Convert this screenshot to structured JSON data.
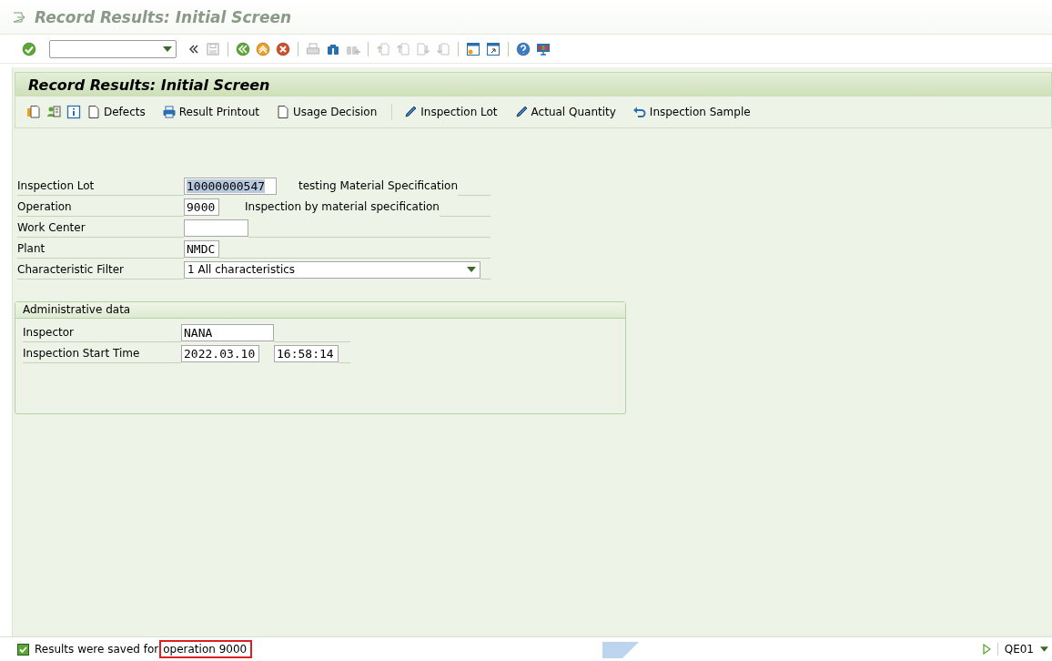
{
  "window": {
    "title": "Record Results: Initial Screen"
  },
  "system_toolbar": {
    "groups": [
      [
        {
          "kind": "enter",
          "disabled": false
        }
      ],
      [
        {
          "kind": "collapse",
          "disabled": false
        },
        {
          "kind": "save",
          "disabled": true
        }
      ],
      [
        {
          "kind": "back",
          "disabled": false
        },
        {
          "kind": "exit",
          "disabled": false
        },
        {
          "kind": "cancel",
          "disabled": false
        }
      ],
      [
        {
          "kind": "print",
          "disabled": true
        },
        {
          "kind": "find",
          "disabled": false
        },
        {
          "kind": "find-next",
          "disabled": true
        }
      ],
      [
        {
          "kind": "first-page",
          "disabled": true
        },
        {
          "kind": "previous-page",
          "disabled": true
        },
        {
          "kind": "next-page",
          "disabled": true
        },
        {
          "kind": "last-page",
          "disabled": true
        }
      ],
      [
        {
          "kind": "new-session",
          "disabled": false
        },
        {
          "kind": "shortcut",
          "disabled": false
        }
      ],
      [
        {
          "kind": "help",
          "disabled": false
        },
        {
          "kind": "layout",
          "disabled": false
        }
      ]
    ]
  },
  "screen_title": "Record Results: Initial Screen",
  "application_toolbar": [
    [
      {
        "kind": "change-view"
      },
      {
        "kind": "person-list"
      },
      {
        "kind": "info"
      },
      {
        "kind": "document",
        "label": "Defects"
      },
      {
        "kind": "printer",
        "label": "Result Printout"
      },
      {
        "kind": "document",
        "label": "Usage Decision"
      }
    ],
    [
      {
        "kind": "pencil",
        "label": "Inspection Lot"
      },
      {
        "kind": "pencil",
        "label": "Actual Quantity"
      },
      {
        "kind": "undo",
        "label": "Inspection Sample"
      }
    ]
  ],
  "fields": [
    {
      "label": "Inspection Lot",
      "kind": "input",
      "value": "10000000547",
      "highlighted": true,
      "description": "testing Material Specification"
    },
    {
      "label": "Operation",
      "kind": "input",
      "value": "9000",
      "description": "Inspection by material specification"
    },
    {
      "label": "Work Center",
      "kind": "input"
    },
    {
      "label": "Plant",
      "kind": "input",
      "value": "NMDC"
    },
    {
      "label": "Characteristic Filter",
      "kind": "dropdown",
      "value": "1 All characteristics"
    }
  ],
  "administrative_data": {
    "title": "Administrative data",
    "fields": [
      {
        "label": "Inspector",
        "values": [
          "NANA"
        ]
      },
      {
        "label": "Inspection Start Time",
        "values": [
          "2022.03.10",
          "16:58:14"
        ]
      }
    ]
  },
  "status_bar": {
    "message": "Results were saved for",
    "highlighted_part": "operation 9000",
    "transaction": "QE01"
  }
}
